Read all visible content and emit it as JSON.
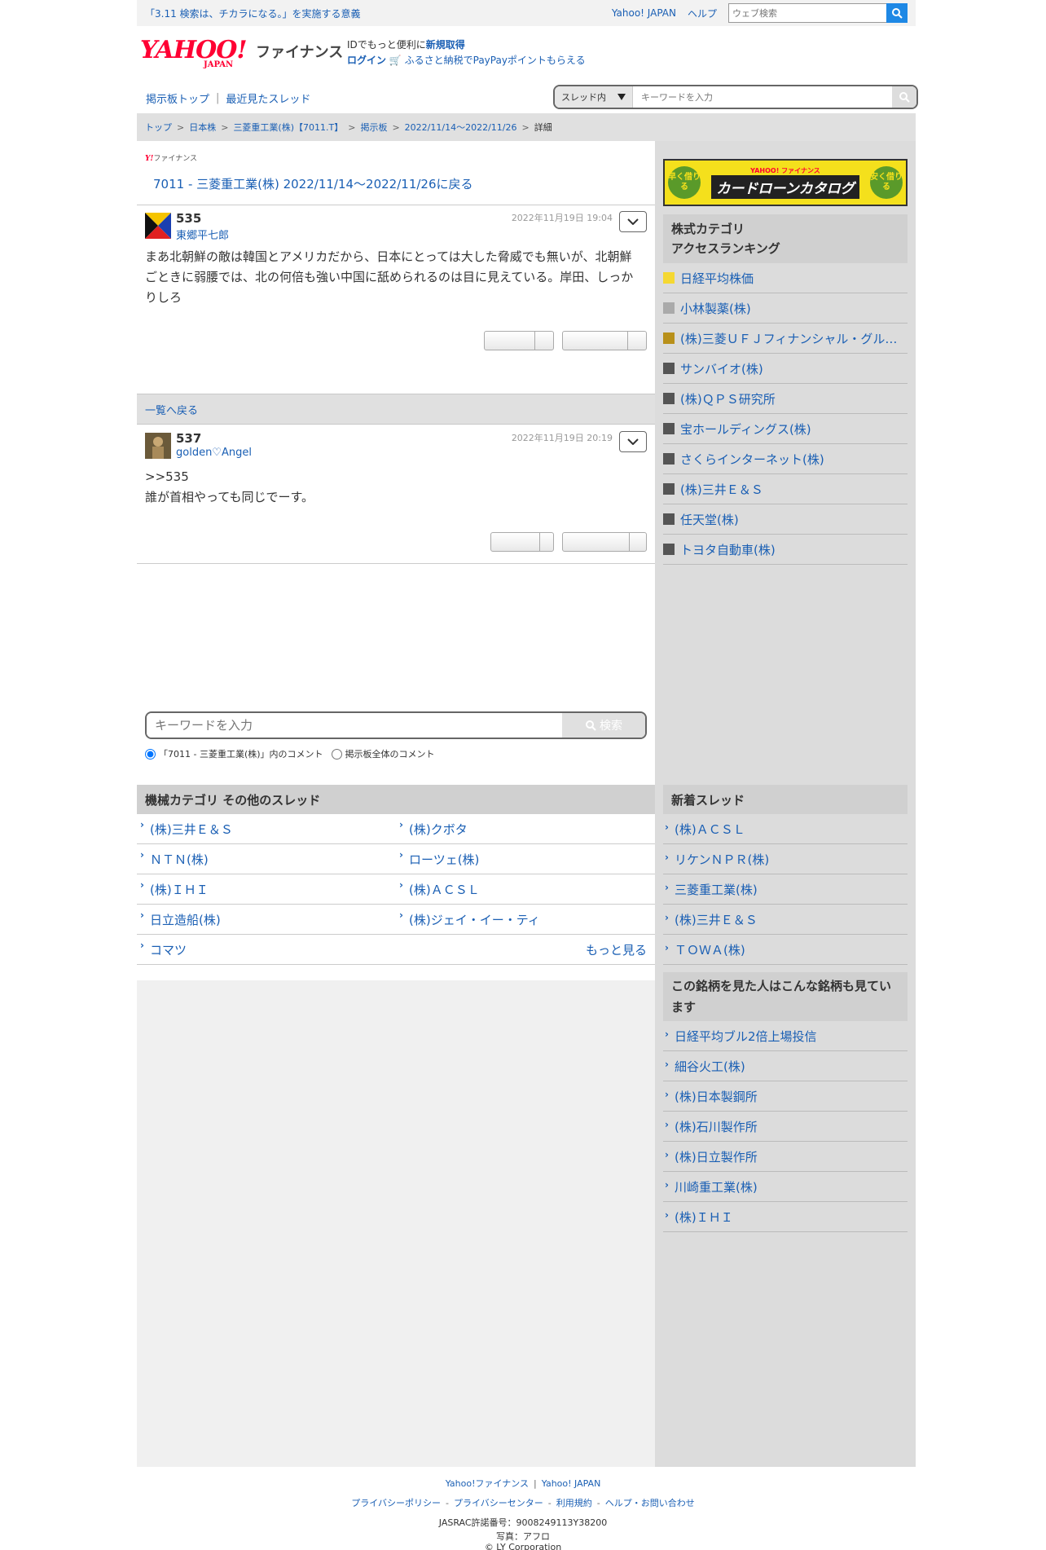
{
  "topbar": {
    "notice": "「3.11 検索は、チカラになる。」を実施する意義",
    "yahoo_japan": "Yahoo! JAPAN",
    "help": "ヘルプ",
    "web_search_placeholder": "ウェブ検索"
  },
  "header": {
    "logo_yahoo": "YAHOO!",
    "logo_japan": "JAPAN",
    "logo_finance": "ファイナンス",
    "id_text": "IDでもっと便利に",
    "id_signup": "新規取得",
    "login": "ログイン",
    "furusato": "ふるさと納税でPayPayポイントもらえる"
  },
  "boardnav": {
    "board_top": "掲示板トップ",
    "sep": "|",
    "recent": "最近見たスレッド"
  },
  "thread_search": {
    "scope": "スレッド内",
    "placeholder": "キーワードを入力"
  },
  "breadcrumb": [
    "トップ",
    "日本株",
    "三菱重工業(株)【7011.T】",
    "掲示板",
    "2022/11/14〜2022/11/26",
    "詳細"
  ],
  "main": {
    "sublogo_y": "Y!",
    "sublogo_fin": "ファイナンス",
    "thread_title": "7011 - 三菱重工業(株) 2022/11/14〜2022/11/26に戻る",
    "back_to_list": "一覧へ戻る",
    "posts": [
      {
        "num": "535",
        "author": "東郷平七郎",
        "date": "2022年11月19日 19:04",
        "body": "まあ北朝鮮の敵は韓国とアメリカだから、日本にとっては大した脅威でも無いが、北朝鮮ごときに弱腰では、北の何倍も強い中国に舐められるのは目に見えている。岸田、しっかりしろ"
      },
      {
        "num": "537",
        "author": "golden♡Angel",
        "date": "2022年11月19日 20:19",
        "body_line1": ">>535",
        "body_line2": "誰が首相やっても同じでーす。"
      }
    ],
    "keyword_search": {
      "placeholder": "キーワードを入力",
      "button": "検索",
      "radio1": "「7011 - 三菱重工業(株)」内のコメント",
      "radio2": "掲示板全体のコメント"
    },
    "other_threads": {
      "heading": "機械カテゴリ  その他のスレッド",
      "items": [
        "(株)三井Ｅ＆Ｓ",
        "(株)クボタ",
        "ＮＴＮ(株)",
        "ローツェ(株)",
        "(株)ＩＨＩ",
        "(株)ＡＣＳＬ",
        "日立造船(株)",
        "(株)ジェイ・イー・ティ",
        "コマツ"
      ],
      "more": "もっと見る"
    }
  },
  "side": {
    "banner": {
      "left": "早く借りる",
      "brand": "YAHOO! ファイナンス",
      "title": "カードローンカタログ",
      "right": "安く借りる"
    },
    "ranking": {
      "heading_line1": "株式カテゴリ",
      "heading_line2": "アクセスランキング",
      "items": [
        {
          "name": "日経平均株価",
          "color": "#f5d832"
        },
        {
          "name": "小林製薬(株)",
          "color": "#aaaaaa"
        },
        {
          "name": "(株)三菱ＵＦＪフィナンシャル・グループ",
          "color": "#b8901a"
        },
        {
          "name": "サンバイオ(株)",
          "color": "#555555"
        },
        {
          "name": "(株)ＱＰＳ研究所",
          "color": "#555555"
        },
        {
          "name": "宝ホールディングス(株)",
          "color": "#555555"
        },
        {
          "name": "さくらインターネット(株)",
          "color": "#555555"
        },
        {
          "name": "(株)三井Ｅ＆Ｓ",
          "color": "#555555"
        },
        {
          "name": "任天堂(株)",
          "color": "#555555"
        },
        {
          "name": "トヨタ自動車(株)",
          "color": "#555555"
        }
      ]
    },
    "new_threads": {
      "heading": "新着スレッド",
      "items": [
        "(株)ＡＣＳＬ",
        "リケンＮＰＲ(株)",
        "三菱重工業(株)",
        "(株)三井Ｅ＆Ｓ",
        "ＴＯＷＡ(株)"
      ]
    },
    "also_viewed": {
      "heading": "この銘柄を見た人はこんな銘柄も見ています",
      "items": [
        "日経平均ブル2倍上場投信",
        "細谷火工(株)",
        "(株)日本製鋼所",
        "(株)石川製作所",
        "(株)日立製作所",
        "川崎重工業(株)",
        "(株)ＩＨＩ"
      ]
    }
  },
  "footer": {
    "finance": "Yahoo!ファイナンス",
    "yj": "Yahoo! JAPAN",
    "privacy_policy": "プライバシーポリシー",
    "privacy_center": "プライバシーセンター",
    "terms": "利用規約",
    "help": "ヘルプ・お問い合わせ",
    "jasrac": "JASRAC許諾番号：9008249113Y38200",
    "photo": "写真：アフロ",
    "copyright": "© LY Corporation"
  }
}
